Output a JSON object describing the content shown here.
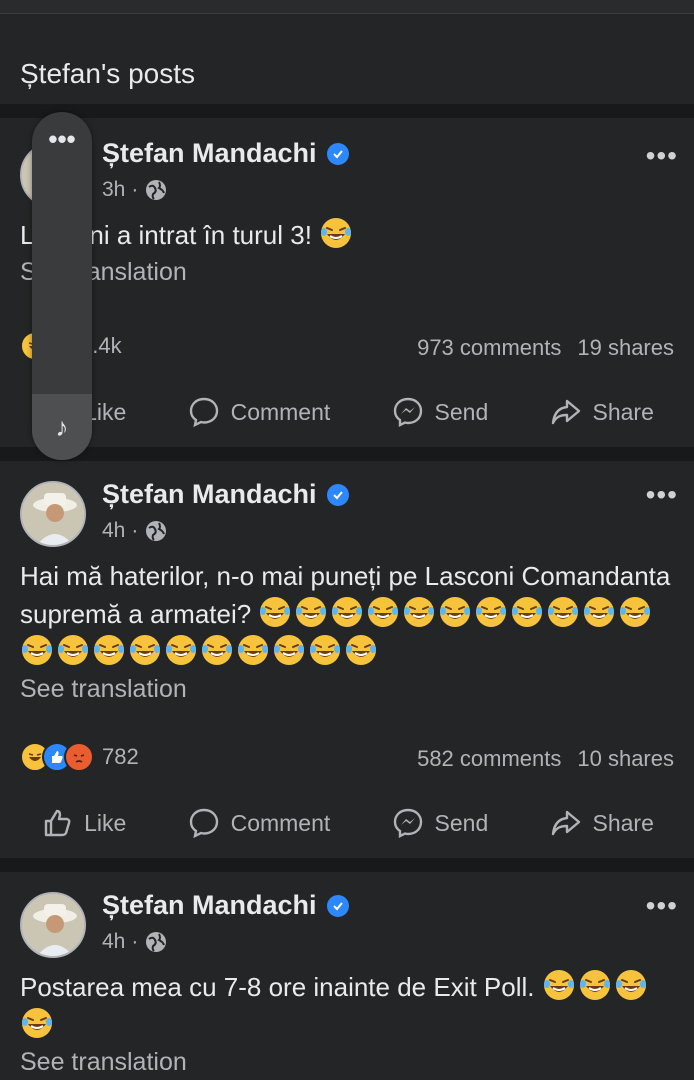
{
  "section_title": "Ștefan's posts",
  "posts": [
    {
      "author": "Ștefan Mandachi",
      "time": "3h",
      "separator": "·",
      "text": "Lasconi a intrat în turul 3!",
      "emoji_count": 1,
      "see_translation": "See translation",
      "reactions_count": "1.4k",
      "comments": "973 comments",
      "shares": "19 shares"
    },
    {
      "author": "Ștefan Mandachi",
      "time": "4h",
      "separator": "·",
      "text": "Hai mă haterilor, n-o mai puneți pe Lasconi Comandanta supremă a armatei?",
      "emoji_count": 21,
      "see_translation": "See translation",
      "reactions_count": "782",
      "comments": "582 comments",
      "shares": "10 shares"
    },
    {
      "author": "Ștefan Mandachi",
      "time": "4h",
      "separator": "·",
      "text": "Postarea mea cu 7-8 ore inainte de Exit Poll.",
      "emoji_count": 4,
      "see_translation": "See translation"
    }
  ],
  "actions": {
    "like": "Like",
    "comment": "Comment",
    "send": "Send",
    "share": "Share"
  },
  "overlay": {
    "dots": "•••",
    "music_icon": "♪"
  },
  "more_label": "•••",
  "icons": {
    "more": "more-options-icon",
    "globe": "globe-icon",
    "verified": "verified-badge-icon",
    "like": "thumbs-up-icon",
    "comment": "comment-bubble-icon",
    "send": "messenger-icon",
    "share": "share-arrow-icon",
    "emoji": "laughing-tears-emoji"
  },
  "colors": {
    "background": "#242526",
    "divider": "#18191a",
    "text_primary": "#e9eaec",
    "text_secondary": "#b0b3b8",
    "verified_blue": "#2d88ff",
    "emoji_yellow": "#f7c33c"
  }
}
